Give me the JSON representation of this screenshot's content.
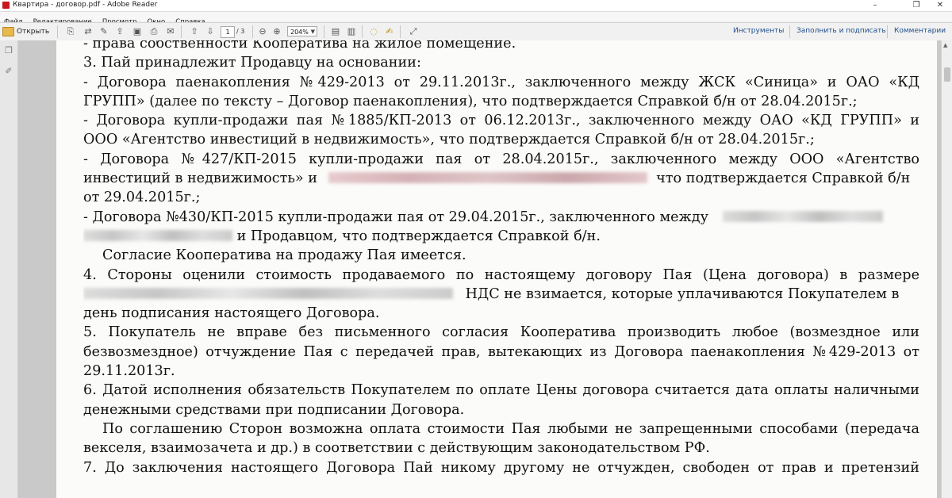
{
  "window": {
    "title": "Квартира - договор.pdf - Adobe Reader",
    "controls": {
      "minimize": "–",
      "maximize": "❐",
      "close": "✕"
    }
  },
  "menu": [
    "Файл",
    "Редактирование",
    "Просмотр",
    "Окно",
    "Справка"
  ],
  "toolbar": {
    "open_label": "Открыть",
    "page_current": "1",
    "page_total": "/ 3",
    "zoom": "204%",
    "tools_label": "Инструменты",
    "fill_sign_label": "Заполнить и подписать",
    "comment_label": "Комментарии",
    "icons": [
      "create-pdf-icon",
      "print-icon",
      "email-icon",
      "prev-page-icon",
      "next-page-icon",
      "zoom-out-icon",
      "zoom-in-icon",
      "fit-page-icon",
      "comment-icon",
      "highlight-icon",
      "expand-icon"
    ]
  },
  "document": {
    "lines": [
      "- права собственности Кооператива на жилое помещение.",
      "3. Пай принадлежит Продавцу на основании:",
      "- Договора паенакопления №429-2013 от 29.11.2013г., заключенного между ЖСК «Синица» и ОАО «КД",
      "ГРУПП» (далее по тексту – Договор паенакопления), что подтверждается Справкой  б/н от 28.04.2015г.;",
      "- Договора купли-продажи пая №1885/КП-2013 от 06.12.2013г., заключенного между ОАО  «КД ГРУПП» и",
      "ООО «Агентство инвестиций в недвижимость», что подтверждается Справкой б/н от 28.04.2015г.;",
      "-   Договора №427/КП-2015 купли-продажи пая от 28.04.2015г., заключенного между ООО «Агентство",
      "инвестиций в недвижимость» и",
      "что подтверждается Справкой б/н",
      "от 29.04.2015г.;",
      "- Договора №430/КП-2015 купли-продажи пая от 29.04.2015г., заключенного между",
      "и Продавцом, что подтверждается Справкой б/н.",
      "Согласие Кооператива на продажу Пая имеется.",
      "4. Стороны оценили стоимость продаваемого по настоящему договору Пая (Цена договора) в размере",
      "НДС не взимается, которые уплачиваются Покупателем в",
      "день подписания настоящего Договора.",
      "5. Покупатель не вправе без письменного согласия Кооператива производить любое (возмездное или",
      "безвозмездное) отчуждение Пая с передачей прав, вытекающих из Договора паенакопления №429-2013 от",
      "29.11.2013г.",
      "6. Датой исполнения обязательств Покупателем по оплате Цены договора считается дата оплаты наличными",
      "денежными средствами при подписании Договора.",
      "По соглашению Сторон возможна оплата стоимости Пая любыми не запрещенными способами (передача",
      "векселя, взаимозачета и др.) в соответствии с действующим законодательством РФ.",
      "7. До заключения настоящего Договора Пай никому другому не отчужден, свободен от прав и претензий"
    ]
  }
}
